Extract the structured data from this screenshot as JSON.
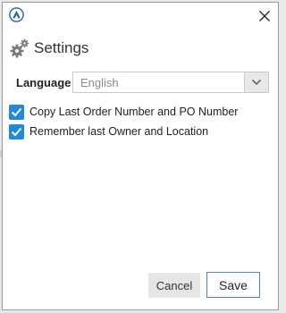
{
  "window": {
    "logo_icon": "app-logo-icon",
    "close_icon": "close-icon"
  },
  "header": {
    "icon": "gear-icon",
    "title": "Settings"
  },
  "language": {
    "label": "Language",
    "selected": "English",
    "dropdown_icon": "chevron-down-icon"
  },
  "options": [
    {
      "label": "Copy Last Order Number and PO Number",
      "checked": true
    },
    {
      "label": "Remember last Owner and Location",
      "checked": true
    }
  ],
  "buttons": {
    "cancel_label": "Cancel",
    "save_label": "Save"
  },
  "colors": {
    "checkbox_fill": "#2388d6",
    "save_border": "#5c7fb0"
  }
}
